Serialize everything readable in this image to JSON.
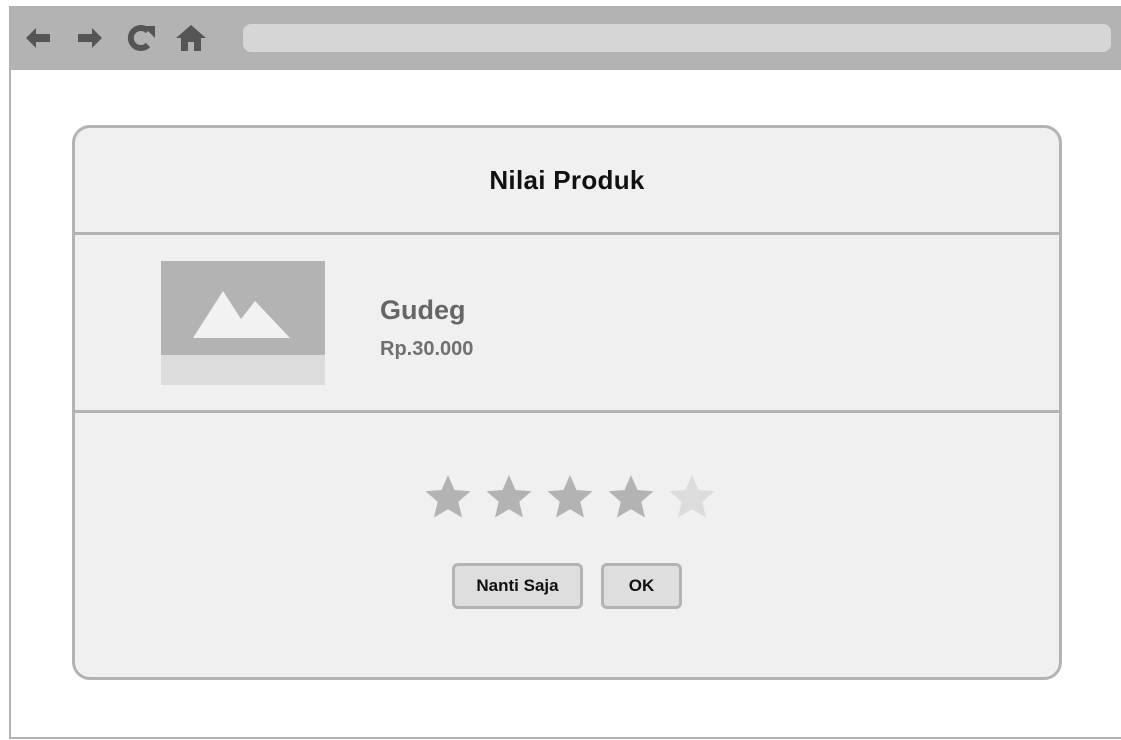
{
  "browser": {
    "nav_icons": [
      "back-arrow-icon",
      "forward-arrow-icon",
      "reload-icon",
      "home-icon"
    ],
    "address_bar": ""
  },
  "dialog": {
    "title": "Nilai Produk",
    "product": {
      "name": "Gudeg",
      "price": "Rp.30.000",
      "image_icon": "image-placeholder-icon"
    },
    "rating": {
      "value": 4,
      "max": 5
    },
    "buttons": {
      "later_label": "Nanti Saja",
      "ok_label": "OK"
    }
  },
  "colors": {
    "chrome": "#b3b3b3",
    "address_bar": "#d6d6d6",
    "dialog_bg": "#f0f0f0",
    "star_filled": "#b3b3b3",
    "star_empty": "#dcdcdc",
    "title_text": "#111111",
    "product_text": "#666666"
  }
}
